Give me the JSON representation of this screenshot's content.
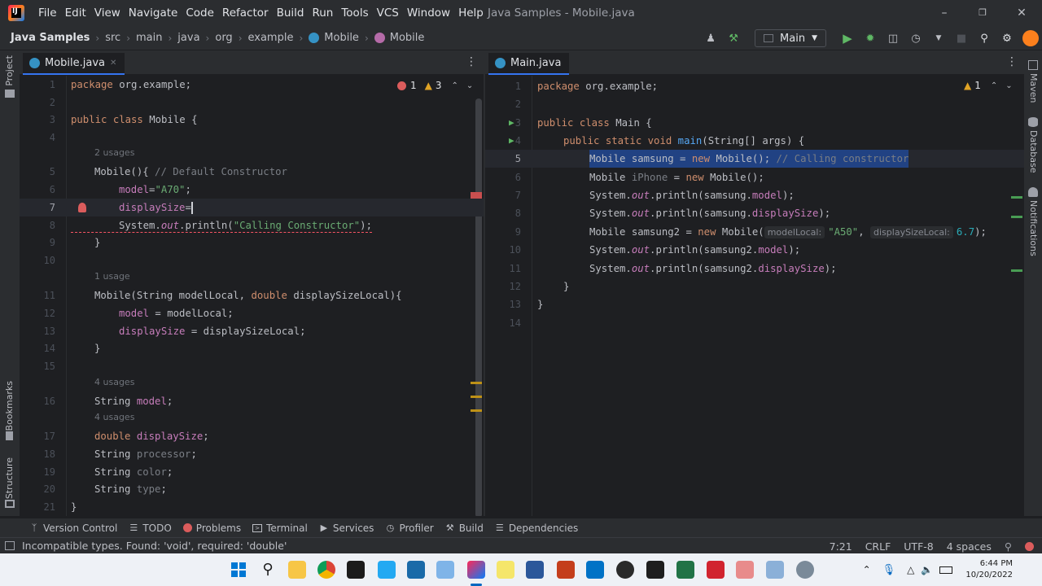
{
  "menu": [
    "File",
    "Edit",
    "View",
    "Navigate",
    "Code",
    "Refactor",
    "Build",
    "Run",
    "Tools",
    "VCS",
    "Window",
    "Help"
  ],
  "window_title": "Java Samples - Mobile.java",
  "breadcrumb": {
    "project": "Java Samples",
    "items": [
      "src",
      "main",
      "java",
      "org",
      "example"
    ],
    "class1": "Mobile",
    "class2": "Mobile"
  },
  "run_config": "Main",
  "left_strip": {
    "project": "Project",
    "bookmarks": "Bookmarks",
    "structure": "Structure"
  },
  "right_strip": {
    "maven": "Maven",
    "database": "Database",
    "notifications": "Notifications"
  },
  "left_editor": {
    "tab": "Mobile.java",
    "errors": "1",
    "warnings": "3",
    "lines": [
      "1",
      "2",
      "3",
      "4",
      "5",
      "6",
      "7",
      "8",
      "9",
      "10",
      "11",
      "12",
      "13",
      "14",
      "15",
      "16",
      "17",
      "18",
      "19",
      "20",
      "21"
    ],
    "code": {
      "l1_kw": "package",
      "l1_rest": " org.example;",
      "l3_kw": "public class",
      "l3_rest": " Mobile {",
      "hint5": "2 usages",
      "l5_a": "Mobile(){ ",
      "l5_cmt": "// Default Constructor",
      "l6_fld": "model",
      "l6_eq": "=",
      "l6_str": "\"A70\"",
      "l6_end": ";",
      "l7_fld": "displaySize",
      "l7_eq": "=",
      "l8_a": "System.",
      "l8_out": "out",
      "l8_b": ".println(",
      "l8_str": "\"Calling Constructor\"",
      "l8_end": ");",
      "l9": "}",
      "hint11": "1 usage",
      "l11_a": "Mobile(String modelLocal, ",
      "l11_kw": "double",
      "l11_b": " displaySizeLocal){",
      "l12_fld": "model",
      "l12_rest": " = modelLocal;",
      "l13_fld": "displaySize",
      "l13_rest": " = displaySizeLocal;",
      "l14": "}",
      "hint16": "4 usages",
      "l16_a": "String ",
      "l16_fld": "model",
      "l16_end": ";",
      "hint17": "4 usages",
      "l17_kw": "double",
      "l17_sp": " ",
      "l17_fld": "displaySize",
      "l17_end": ";",
      "l18_a": "String ",
      "l18_fld": "processor",
      "l18_end": ";",
      "l19_a": "String ",
      "l19_fld": "color",
      "l19_end": ";",
      "l20_a": "String ",
      "l20_fld": "type",
      "l20_end": ";",
      "l21": "}"
    }
  },
  "right_editor": {
    "tab": "Main.java",
    "warnings": "1",
    "lines": [
      "1",
      "2",
      "3",
      "4",
      "5",
      "6",
      "7",
      "8",
      "9",
      "10",
      "11",
      "12",
      "13",
      "14"
    ],
    "code": {
      "l1_kw": "package",
      "l1_rest": " org.example;",
      "l3_kw": "public class",
      "l3_rest": " Main {",
      "l4_kw": "public static void",
      "l4_sp": " ",
      "l4_m": "main",
      "l4_rest": "(String[] args) {",
      "l5_a": "Mobile samsung = ",
      "l5_kw": "new",
      "l5_b": " Mobile(); ",
      "l5_cmt": "// Calling constructor",
      "l6_a": "Mobile ",
      "l6_un": "iPhone",
      "l6_b": " = ",
      "l6_kw": "new",
      "l6_c": " Mobile();",
      "l7_a": "System.",
      "l7_out": "out",
      "l7_b": ".println(samsung.",
      "l7_fld": "model",
      "l7_end": ");",
      "l8_a": "System.",
      "l8_out": "out",
      "l8_b": ".println(samsung.",
      "l8_fld": "displaySize",
      "l8_end": ");",
      "l9_a": "Mobile samsung2 = ",
      "l9_kw": "new",
      "l9_b": " Mobile(",
      "l9_h1": "modelLocal:",
      "l9_str": "\"A50\"",
      "l9_c": ", ",
      "l9_h2": "displaySizeLocal:",
      "l9_num": "6.7",
      "l9_end": ");",
      "l10_a": "System.",
      "l10_out": "out",
      "l10_b": ".println(samsung2.",
      "l10_fld": "model",
      "l10_end": ");",
      "l11_a": "System.",
      "l11_out": "out",
      "l11_b": ".println(samsung2.",
      "l11_fld": "displaySize",
      "l11_end": ");",
      "l12": "}",
      "l13": "}"
    }
  },
  "bottom_tools": [
    "Version Control",
    "TODO",
    "Problems",
    "Terminal",
    "Services",
    "Profiler",
    "Build",
    "Dependencies"
  ],
  "status": {
    "message": "Incompatible types. Found: 'void', required: 'double'",
    "position": "7:21",
    "line_sep": "CRLF",
    "encoding": "UTF-8",
    "indent": "4 spaces"
  },
  "taskbar": {
    "time": "6:44 PM",
    "date": "10/20/2022"
  },
  "colors": {
    "keyword": "#cf8e6d",
    "field": "#c77dbb",
    "string": "#6aab73",
    "comment": "#7a7e85",
    "selection": "#214283",
    "error": "#f75464",
    "accent": "#3574f0"
  }
}
